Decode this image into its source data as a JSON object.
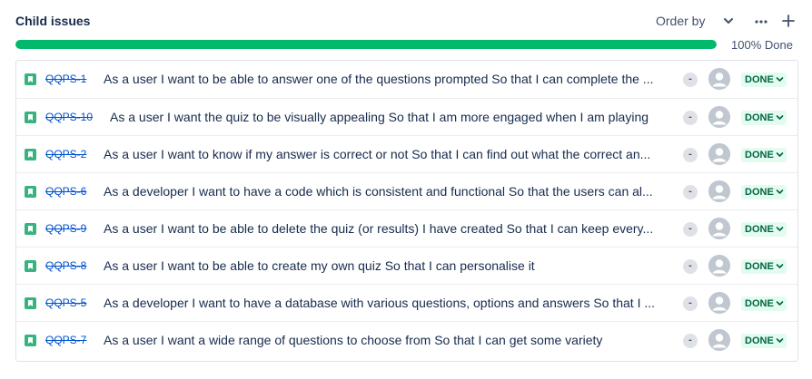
{
  "header": {
    "title": "Child issues",
    "order_by_label": "Order by"
  },
  "progress": {
    "percent_done": 100,
    "label": "100% Done"
  },
  "colors": {
    "progress": "#00b96b",
    "story_icon": "#36b37e",
    "done_badge_bg": "#e3fcef",
    "done_badge_text": "#006644",
    "issue_key": "#0052cc"
  },
  "issues": [
    {
      "key": "QQPS-1",
      "summary": "As a user I want to be able to answer one of the questions prompted So that I can complete the ...",
      "priority": "-",
      "status": "DONE"
    },
    {
      "key": "QQPS-10",
      "summary": "As a user I want the quiz to be visually appealing So that I am more engaged when I am playing",
      "priority": "-",
      "status": "DONE"
    },
    {
      "key": "QQPS-2",
      "summary": "As a user I want to know if my answer is correct or not So that I can find out what the correct an...",
      "priority": "-",
      "status": "DONE"
    },
    {
      "key": "QQPS-6",
      "summary": "As a developer I want to have a code which is consistent and functional So that the users can al...",
      "priority": "-",
      "status": "DONE"
    },
    {
      "key": "QQPS-9",
      "summary": "As a user I want to be able to delete the quiz (or results) I have created So that I can keep every...",
      "priority": "-",
      "status": "DONE"
    },
    {
      "key": "QQPS-8",
      "summary": "As a user I want to be able to create my own quiz So that I can personalise it",
      "priority": "-",
      "status": "DONE"
    },
    {
      "key": "QQPS-5",
      "summary": "As a developer I want to have a database with various questions, options and answers So that I ...",
      "priority": "-",
      "status": "DONE"
    },
    {
      "key": "QQPS-7",
      "summary": "As a user I want a wide range of questions to choose from So that I can get some variety",
      "priority": "-",
      "status": "DONE"
    }
  ]
}
